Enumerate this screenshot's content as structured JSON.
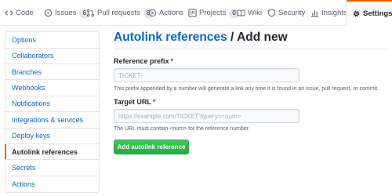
{
  "repo_nav": {
    "tabs": [
      {
        "label": "Code",
        "icon": "code-icon"
      },
      {
        "label": "Issues",
        "icon": "issue-icon",
        "count": "6"
      },
      {
        "label": "Pull requests",
        "icon": "pull-request-icon",
        "count": "8"
      },
      {
        "label": "Actions",
        "icon": "play-icon"
      },
      {
        "label": "Projects",
        "icon": "project-icon",
        "count": "0"
      },
      {
        "label": "Wiki",
        "icon": "book-icon"
      },
      {
        "label": "Security",
        "icon": "shield-icon"
      },
      {
        "label": "Insights",
        "icon": "graph-icon"
      },
      {
        "label": "Settings",
        "icon": "gear-icon",
        "selected": true
      }
    ]
  },
  "sidebar": {
    "items": [
      {
        "label": "Options"
      },
      {
        "label": "Collaborators"
      },
      {
        "label": "Branches"
      },
      {
        "label": "Webhooks"
      },
      {
        "label": "Notifications"
      },
      {
        "label": "Integrations & services"
      },
      {
        "label": "Deploy keys"
      },
      {
        "label": "Autolink references",
        "active": true
      },
      {
        "label": "Secrets"
      },
      {
        "label": "Actions"
      }
    ]
  },
  "main": {
    "title_link": "Autolink references",
    "title_rest": " / Add new",
    "prefix": {
      "label": "Reference prefix",
      "required_mark": "*",
      "placeholder": "TICKET-",
      "note": "This prefix appended by a number will generate a link any time it is found in an issue, pull request, or commit."
    },
    "url": {
      "label": "Target URL",
      "required_mark": "*",
      "placeholder": "https://example.com/TICKET?query=<num>",
      "note": "The URL must contain <num> for the reference number."
    },
    "submit_label": "Add autolink reference"
  },
  "colors": {
    "accent": "#e36209",
    "link": "#0366d6",
    "primary_button": "#28a745",
    "required": "#cb2431"
  }
}
